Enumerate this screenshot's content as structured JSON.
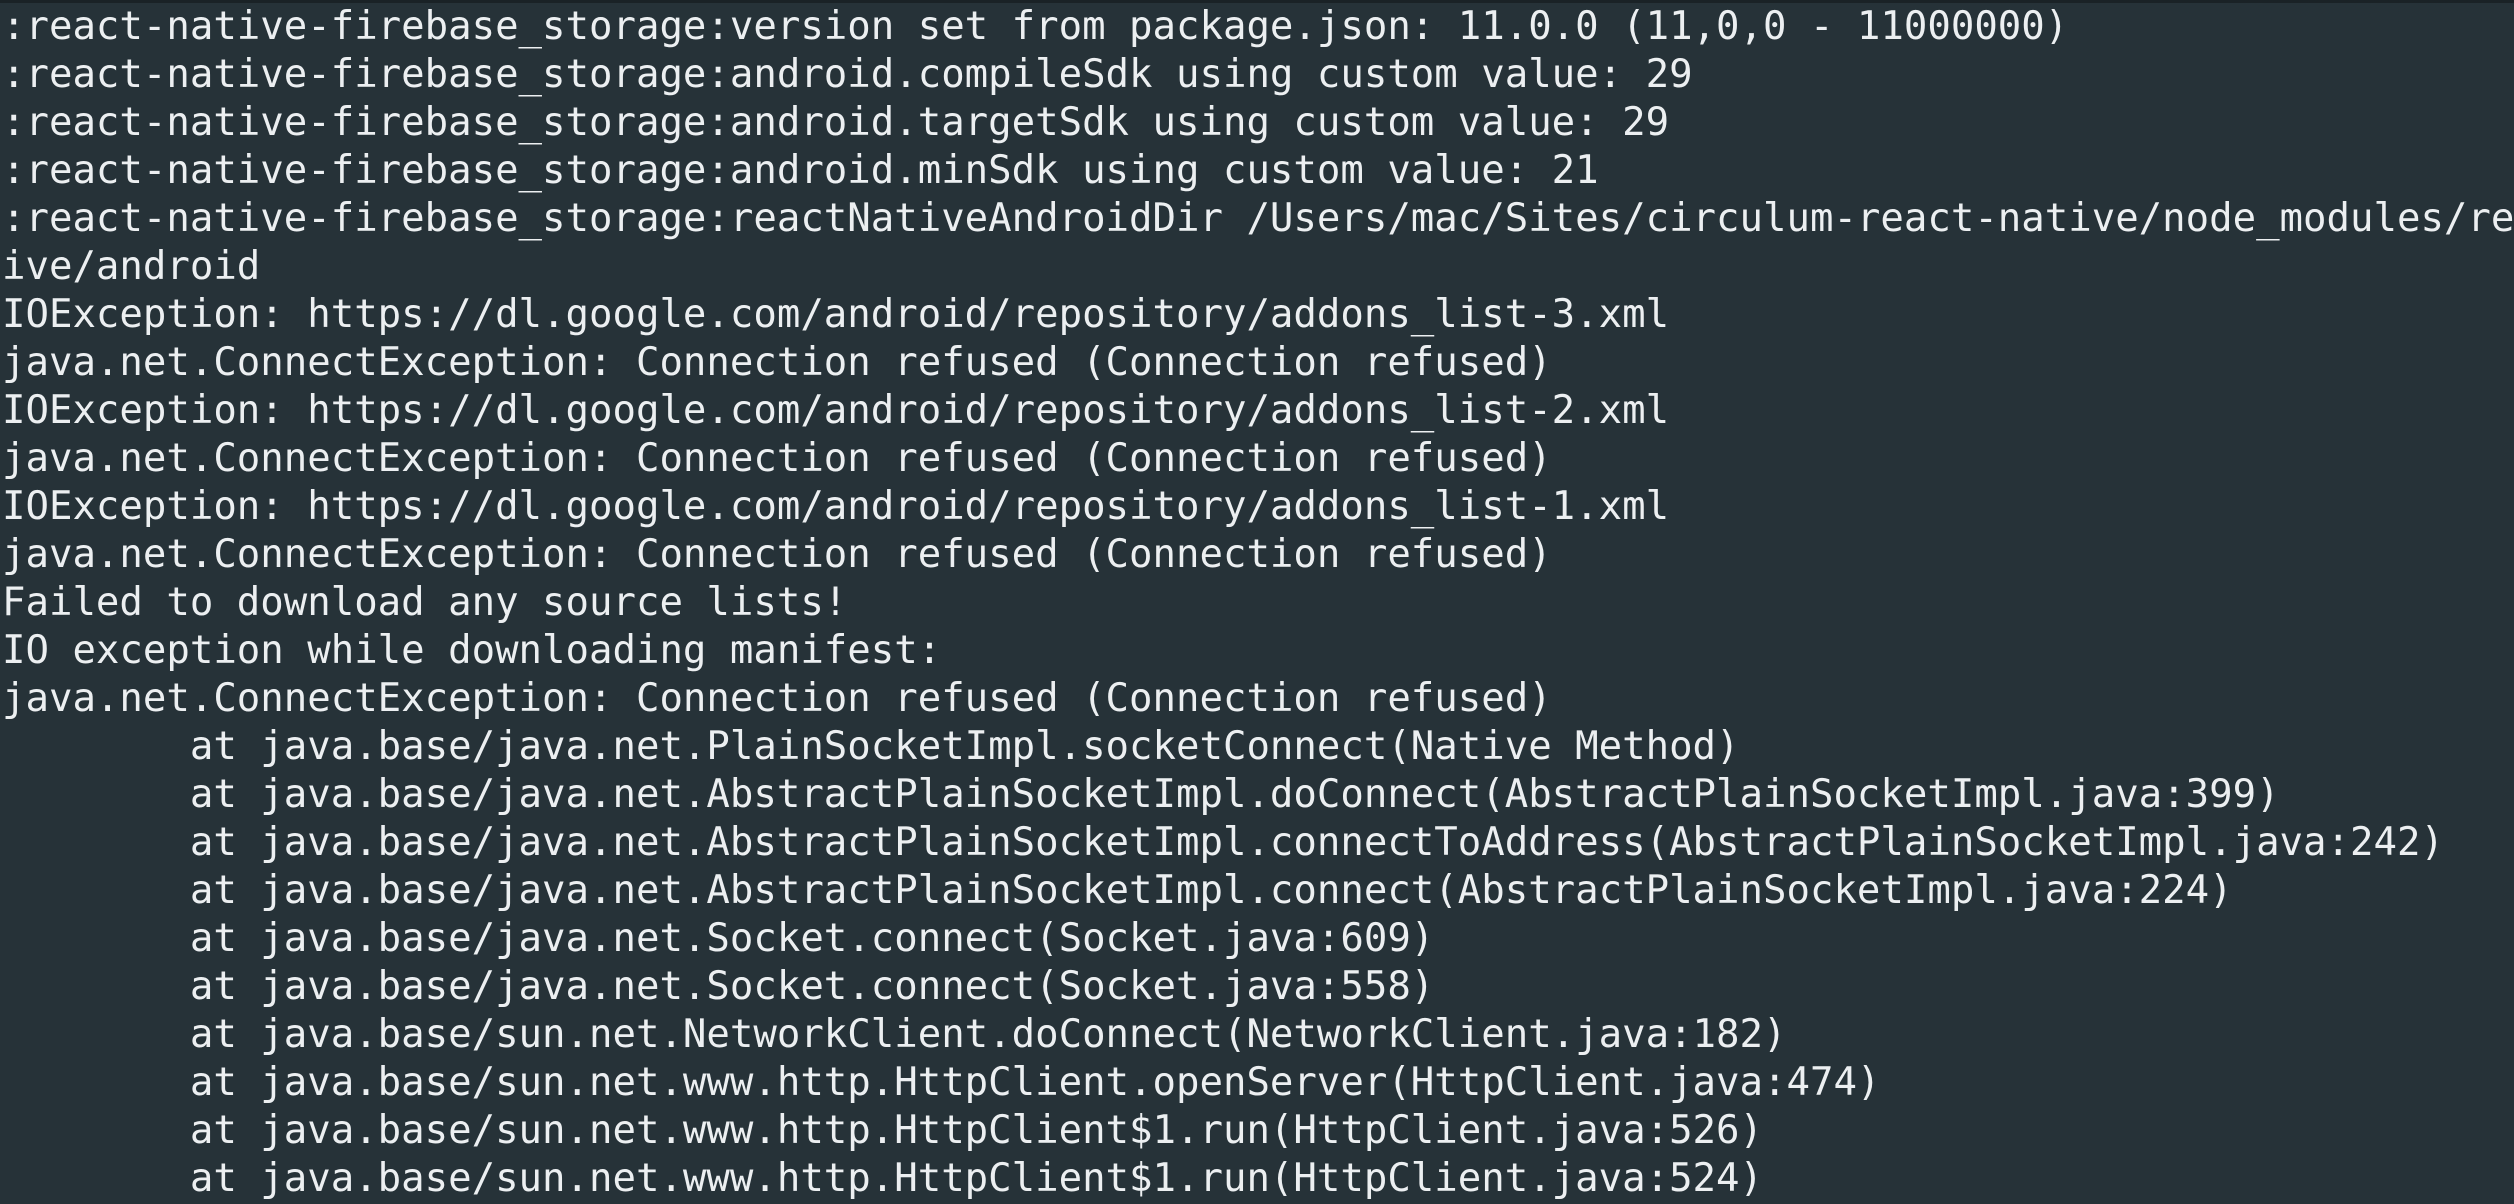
{
  "terminal": {
    "colors": {
      "background": "#263238",
      "foreground": "#eceff1"
    },
    "lines": [
      ":react-native-firebase_storage:version set from package.json: 11.0.0 (11,0,0 - 11000000)",
      ":react-native-firebase_storage:android.compileSdk using custom value: 29",
      ":react-native-firebase_storage:android.targetSdk using custom value: 29",
      ":react-native-firebase_storage:android.minSdk using custom value: 21",
      ":react-native-firebase_storage:reactNativeAndroidDir /Users/mac/Sites/circulum-react-native/node_modules/react-nat",
      "ive/android",
      "IOException: https://dl.google.com/android/repository/addons_list-3.xml",
      "java.net.ConnectException: Connection refused (Connection refused)",
      "IOException: https://dl.google.com/android/repository/addons_list-2.xml",
      "java.net.ConnectException: Connection refused (Connection refused)",
      "IOException: https://dl.google.com/android/repository/addons_list-1.xml",
      "java.net.ConnectException: Connection refused (Connection refused)",
      "Failed to download any source lists!",
      "IO exception while downloading manifest:",
      "java.net.ConnectException: Connection refused (Connection refused)",
      "        at java.base/java.net.PlainSocketImpl.socketConnect(Native Method)",
      "        at java.base/java.net.AbstractPlainSocketImpl.doConnect(AbstractPlainSocketImpl.java:399)",
      "        at java.base/java.net.AbstractPlainSocketImpl.connectToAddress(AbstractPlainSocketImpl.java:242)",
      "        at java.base/java.net.AbstractPlainSocketImpl.connect(AbstractPlainSocketImpl.java:224)",
      "        at java.base/java.net.Socket.connect(Socket.java:609)",
      "        at java.base/java.net.Socket.connect(Socket.java:558)",
      "        at java.base/sun.net.NetworkClient.doConnect(NetworkClient.java:182)",
      "        at java.base/sun.net.www.http.HttpClient.openServer(HttpClient.java:474)",
      "        at java.base/sun.net.www.http.HttpClient$1.run(HttpClient.java:526)",
      "        at java.base/sun.net.www.http.HttpClient$1.run(HttpClient.java:524)"
    ]
  }
}
